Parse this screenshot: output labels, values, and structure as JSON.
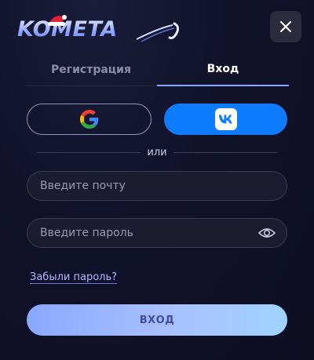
{
  "brand": {
    "logo_text": "KOMETA",
    "accent": "#8aa6ff"
  },
  "tabs": [
    {
      "label": "Регистрация",
      "active": false
    },
    {
      "label": "Вход",
      "active": true
    }
  ],
  "social": {
    "google_icon": "google-icon",
    "vk_icon": "vk-icon"
  },
  "divider_text": "или",
  "email": {
    "placeholder": "Введите почту",
    "value": ""
  },
  "password": {
    "placeholder": "Введите пароль",
    "value": ""
  },
  "forgot_label": "Забыли пароль?",
  "submit_label": "ВХОД"
}
